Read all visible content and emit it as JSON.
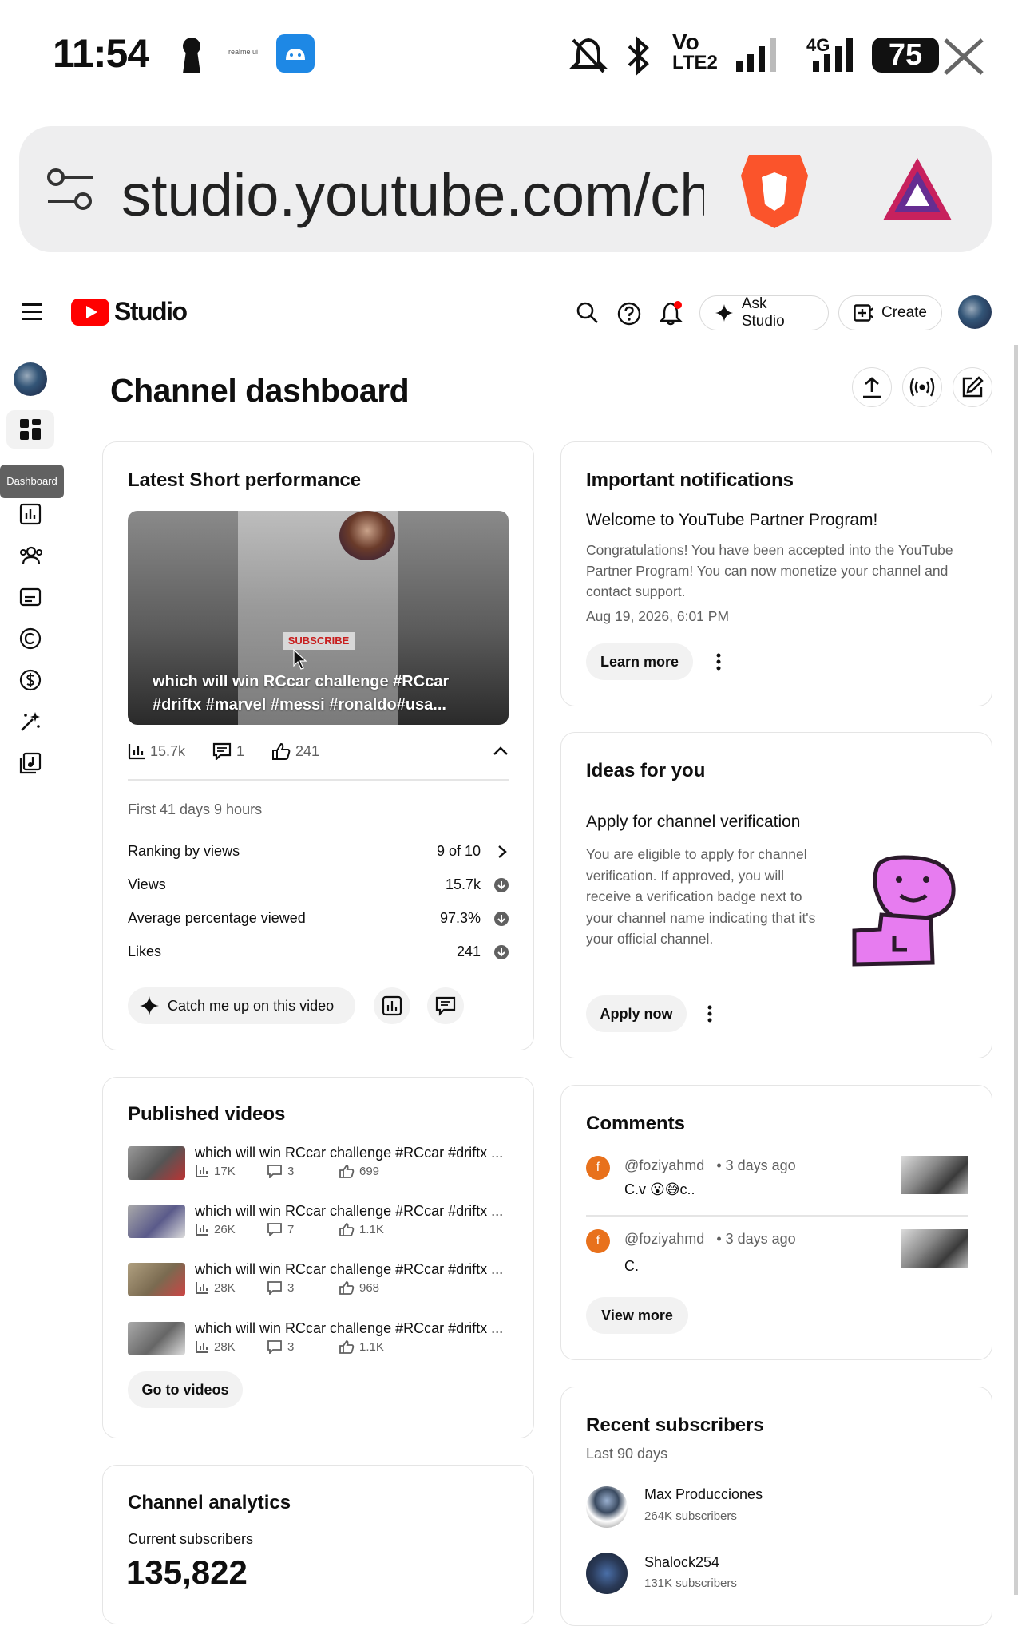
{
  "status_bar": {
    "time": "11:54",
    "brand_small": "realme ui",
    "network": "Vo",
    "network2": "LTE2",
    "network3": "4G",
    "battery": "75"
  },
  "browser": {
    "url": "studio.youtube.com/ch",
    "icons": [
      "site-settings-icon",
      "brave-lion-icon",
      "brave-rewards-icon"
    ]
  },
  "header": {
    "logo_text": "Studio",
    "ask_studio": "Ask Studio",
    "create": "Create"
  },
  "sidebar": {
    "tooltip": "Dashboard"
  },
  "page": {
    "title": "Channel dashboard"
  },
  "latest_short": {
    "title": "Latest Short performance",
    "video_caption": "which will win RCcar challenge #RCcar #driftx #marvel #messi #ronaldo#usa...",
    "thumbnail_label": "SUBSCRIBE",
    "views": "15.7k",
    "comments": "1",
    "likes": "241",
    "period": "First 41 days 9 hours",
    "rows": [
      {
        "label": "Ranking by views",
        "value": "9 of 10"
      },
      {
        "label": "Views",
        "value": "15.7k"
      },
      {
        "label": "Average percentage viewed",
        "value": "97.3%"
      },
      {
        "label": "Likes",
        "value": "241"
      }
    ],
    "catch_up": "Catch me up on this video"
  },
  "published_videos": {
    "title": "Published videos",
    "items": [
      {
        "title": "which will win RCcar challenge #RCcar #driftx ...",
        "views": "17K",
        "comments": "3",
        "likes": "699"
      },
      {
        "title": "which will win RCcar challenge #RCcar #driftx ...",
        "views": "26K",
        "comments": "7",
        "likes": "1.1K"
      },
      {
        "title": "which will win RCcar challenge #RCcar #driftx ...",
        "views": "28K",
        "comments": "3",
        "likes": "968"
      },
      {
        "title": "which will win RCcar challenge #RCcar #driftx ...",
        "views": "28K",
        "comments": "3",
        "likes": "1.1K"
      }
    ],
    "go_to_videos": "Go to videos"
  },
  "channel_analytics": {
    "title": "Channel analytics",
    "subtitle": "Current subscribers",
    "subscribers": "135,822"
  },
  "notifications": {
    "title": "Important notifications",
    "heading": "Welcome to YouTube Partner Program!",
    "body": "Congratulations! You have been accepted into the YouTube Partner Program! You can now monetize your channel and contact support.",
    "date": "Aug 19, 2026, 6:01 PM",
    "learn_more": "Learn more"
  },
  "ideas": {
    "title": "Ideas for you",
    "heading": "Apply for channel verification",
    "body": "You are eligible to apply for channel verification. If approved, you will receive a verification badge next to your channel name indicating that it's your official channel.",
    "apply": "Apply now"
  },
  "comments": {
    "title": "Comments",
    "items": [
      {
        "user": "@foziyahmd",
        "time": "• 3 days ago",
        "text": "C.v 😮😅c..",
        "avatar": "f"
      },
      {
        "user": "@foziyahmd",
        "time": "• 3 days ago",
        "text": "C.",
        "avatar": "f"
      }
    ],
    "view_more": "View more"
  },
  "recent_subscribers": {
    "title": "Recent subscribers",
    "subtitle": "Last 90 days",
    "items": [
      {
        "name": "Max Producciones",
        "subs": "264K subscribers"
      },
      {
        "name": "Shalock254",
        "subs": "131K subscribers"
      }
    ]
  },
  "colors": {
    "youtube_red": "#ff0000",
    "brave_orange": "#fb542b",
    "comment_avatar": "#e8711c",
    "sticker_pink": "#e77cf0"
  }
}
